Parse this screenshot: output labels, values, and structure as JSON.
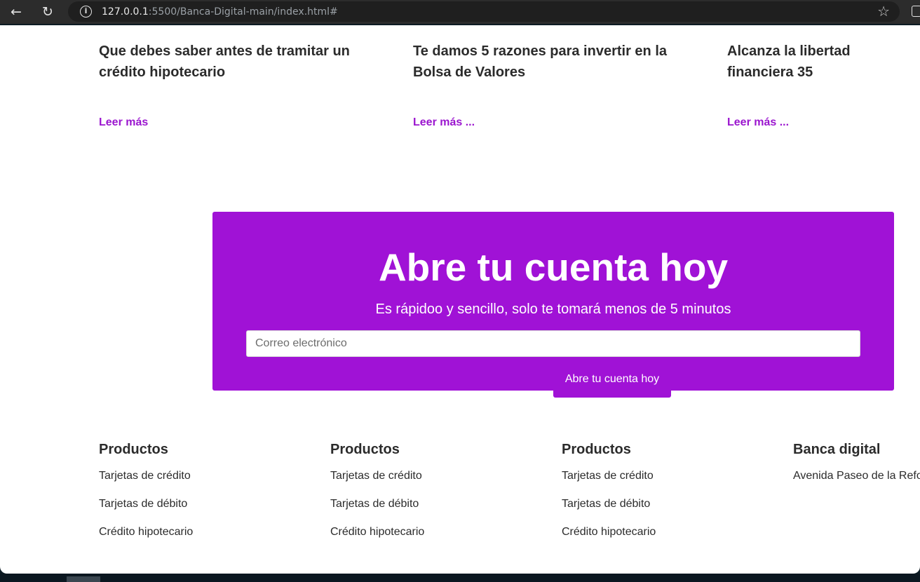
{
  "browser": {
    "url_host": "127.0.0.1",
    "url_rest": ":5500/Banca-Digital-main/index.html#"
  },
  "articles": [
    {
      "title": "Que debes saber antes de tramitar un crédito hipotecario",
      "link": "Leer más"
    },
    {
      "title": "Te damos 5 razones para invertir en la Bolsa de Valores",
      "link": "Leer más ..."
    },
    {
      "title": "Alcanza la libertad financiera 35",
      "link": "Leer más ..."
    }
  ],
  "cta": {
    "title": "Abre tu cuenta hoy",
    "subtitle": "Es rápidoo y sencillo, solo te tomará menos de 5 minutos",
    "email_placeholder": "Correo electrónico",
    "email_value": "",
    "button_label": "Abre tu cuenta hoy",
    "color": "#a012d6"
  },
  "footer": {
    "columns": [
      {
        "title": "Productos",
        "links": [
          "Tarjetas de crédito",
          "Tarjetas de débito",
          "Crédito hipotecario"
        ]
      },
      {
        "title": "Productos",
        "links": [
          "Tarjetas de crédito",
          "Tarjetas de débito",
          "Crédito hipotecario"
        ]
      },
      {
        "title": "Productos",
        "links": [
          "Tarjetas de crédito",
          "Tarjetas de débito",
          "Crédito hipotecario"
        ]
      },
      {
        "title": "Banca digital",
        "links": [
          "Avenida Paseo de la Refo"
        ]
      }
    ]
  },
  "colors": {
    "accent": "#a012d6",
    "link": "#9b16cf",
    "text": "#2b2b2b"
  },
  "icons": {
    "back": "back-arrow-icon",
    "reload": "reload-icon",
    "info": "info-icon",
    "bookmark": "star-icon",
    "side_panel": "side-panel-icon"
  }
}
